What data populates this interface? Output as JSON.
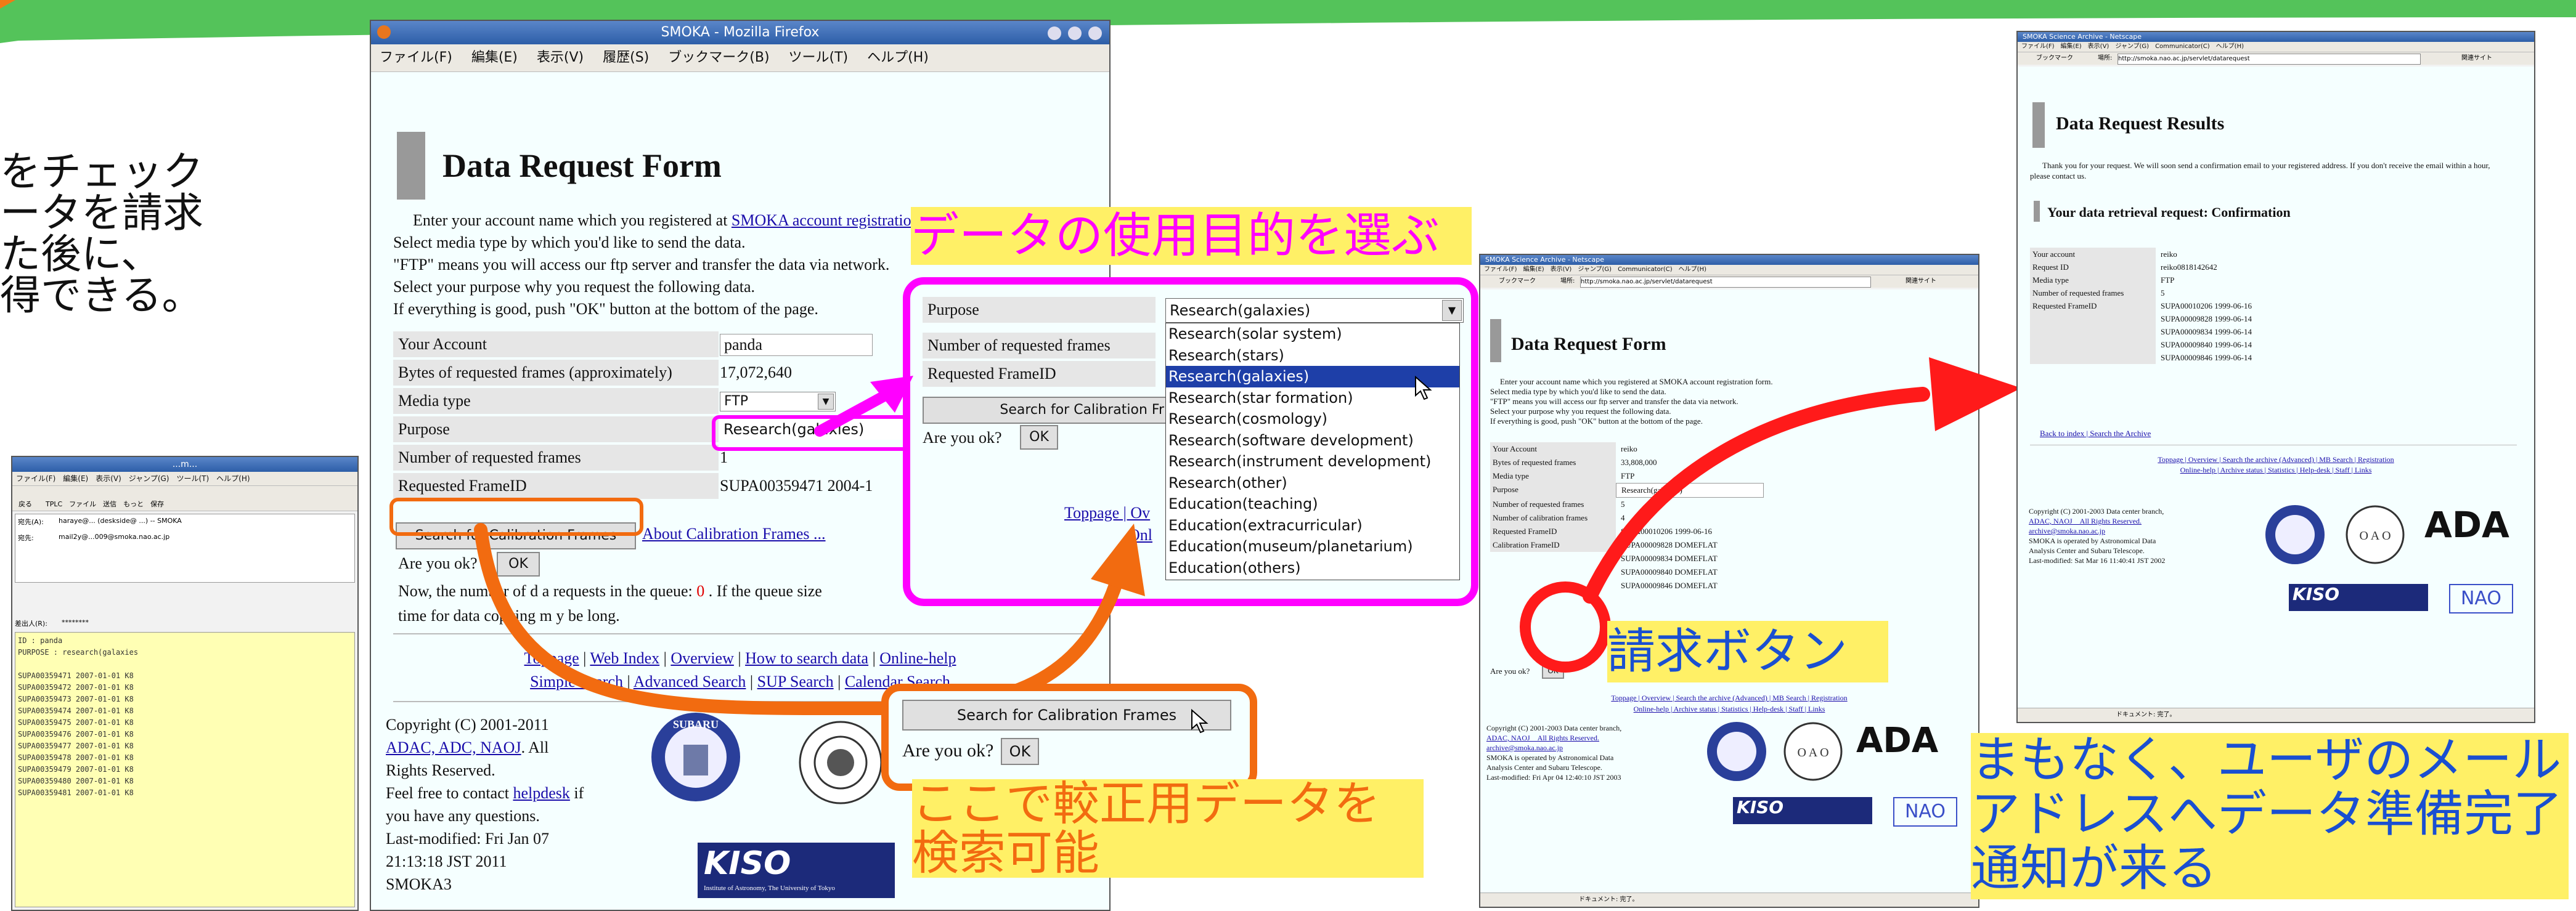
{
  "left_text": {
    "lines": [
      "をチェック",
      "ータを請求",
      "た後に、",
      "得できる。"
    ]
  },
  "small_window": {
    "title": "...m...",
    "menu": "ファイル(F)　編集(E)　表示(V)　ジャンプ(G)　ツール(T)　ヘルプ(H)",
    "toolbar": "戻る　　TPLC　ファイル　送信　もっと　保存",
    "address_label": "宛先(A):",
    "address": "haraye@... (deskside@ ...) -- SMOKA",
    "to_label": "宛先:",
    "to_value": "mail2y@...009@smoka.nao.ac.jp",
    "from_label": "差出人(R):",
    "from_value": "********",
    "body_lines": [
      "ID : panda",
      "PURPOSE : research(galaxies",
      "",
      "SUPA00359471 2007-01-01 K8",
      "SUPA00359472 2007-01-01 K8",
      "SUPA00359473 2007-01-01 K8",
      "SUPA00359474 2007-01-01 K8",
      "SUPA00359475 2007-01-01 K8",
      "SUPA00359476 2007-01-01 K8",
      "SUPA00359477 2007-01-01 K8",
      "SUPA00359478 2007-01-01 K8",
      "SUPA00359479 2007-01-01 K8",
      "SUPA00359480 2007-01-01 K8",
      "SUPA00359481 2007-01-01 K8"
    ]
  },
  "main_window": {
    "title": "SMOKA - Mozilla Firefox",
    "menu": [
      "ファイル(F)",
      "編集(E)",
      "表示(V)",
      "履歴(S)",
      "ブックマーク(B)",
      "ツール(T)",
      "ヘルプ(H)"
    ],
    "heading": "Data Request Form",
    "intro_prefix": "Enter your account name which you registered at",
    "intro_link": "SMOKA account registration form",
    "intro_lines": [
      "Select media type by which you'd like to send the data.",
      "\"FTP\" means you will access our ftp server and transfer the data via network.",
      "Select your purpose why you request the following data.",
      "If everything is good, push \"OK\" button at the bottom of the page."
    ],
    "table": {
      "account_label": "Your Account",
      "account_value": "panda",
      "bytes_label": "Bytes of requested frames (approximately)",
      "bytes_value": "17,072,640",
      "media_label": "Media type",
      "media_value": "FTP",
      "purpose_label": "Purpose",
      "purpose_value": "Research(galaxies)",
      "num_label": "Number of requested frames",
      "num_value": "1",
      "frame_label": "Requested FrameID",
      "frame_value": "SUPA00359471 2004-1"
    },
    "calib_button": "Search for Calibration Frames",
    "calib_link": "About Calibration Frames ...",
    "areyouok": "Are you ok?",
    "ok": "OK",
    "queue_prefix": "Now, the number of d",
    "queue_middle": "a requests in the queue:",
    "queue_count": "0",
    "queue_suffix": ". If the queue size",
    "queue_line2_a": "time for data copying m",
    "queue_line2_b": "y be long.",
    "nav1": [
      "Toppage",
      "Web Index",
      "Overview",
      "How to search data",
      "Online-help"
    ],
    "nav2": [
      "Simple Search",
      "Advanced Search",
      "SUP Search",
      "Calendar Search"
    ],
    "copyright": "Copyright (C) 2001-2011",
    "org_links": "ADAC, ADC, NAOJ",
    "all": ". All",
    "rights": "Rights Reserved.",
    "feelfree": "Feel free to contact",
    "helpdesk": "helpdesk",
    "feelfree_end": "if",
    "questions": "you have any questions.",
    "lastmod": "Last-modified: Fri Jan 07",
    "lastmod2": "21:13:18 JST 2011",
    "smoka": "SMOKA3"
  },
  "dropdown_zoom": {
    "purpose_label": "Purpose",
    "selected": "Research(galaxies)",
    "num_label": "Number of requested frames",
    "frame_label": "Requested FrameID",
    "calib_button": "Search for Calibration Fr",
    "areyouok": "Are you ok?",
    "ok": "OK",
    "partial_link": "Toppage | Ov",
    "partial_link2": "Onl",
    "options": [
      "Research(solar system)",
      "Research(stars)",
      "Research(galaxies)",
      "Research(star formation)",
      "Research(cosmology)",
      "Research(software development)",
      "Research(instrument development)",
      "Research(other)",
      "Education(teaching)",
      "Education(extracurricular)",
      "Education(museum/planetarium)",
      "Education(others)"
    ]
  },
  "calib_zoom": {
    "button": "Search for Calibration Frames",
    "areyouok": "Are you ok?",
    "ok": "OK"
  },
  "netscape_window": {
    "title": "SMOKA Science Archive - Netscape",
    "menu": "ファイル(F)　編集(E)　表示(V)　ジャンプ(G)　Communicator(C)　ヘルプ(H)",
    "bookmark": "ブックマーク",
    "location_label": "場所:",
    "url": "http://smoka.nao.ac.jp/servlet/datarequest",
    "related": "関連サイト",
    "heading": "Data Request Form",
    "intro": [
      "Enter your account name which you registered at SMOKA account registration form.",
      "Select media type by which you'd like to send the data.",
      "\"FTP\" means you will access our ftp server and transfer the data via network.",
      "Select your purpose why you request the following data.",
      "If everything is good, push \"OK\" button at the bottom of the page."
    ],
    "rows": [
      {
        "k": "Your Account",
        "v": "reiko"
      },
      {
        "k": "Bytes of requested frames",
        "v": "33,808,000"
      },
      {
        "k": "Media type",
        "v": "FTP"
      },
      {
        "k": "Purpose",
        "v": "Research(galaxies)"
      },
      {
        "k": "Number of requested frames",
        "v": "5"
      },
      {
        "k": "Number of calibration frames",
        "v": "4"
      },
      {
        "k": "Requested FrameID",
        "v": "SUPA00010206 1999-06-16"
      },
      {
        "k": "Calibration FrameID",
        "v": "SUPA00009828 DOMEFLAT"
      },
      {
        "k": "",
        "v": "SUPA00009834 DOMEFLAT"
      },
      {
        "k": "",
        "v": "SUPA00009840 DOMEFLAT"
      },
      {
        "k": "",
        "v": "SUPA00009846 DOMEFLAT"
      }
    ],
    "areyouok": "Are you ok?",
    "ok": "OK",
    "links1": "Toppage | Overview | Search the archive (Advanced) | MB Search | Registration",
    "links2": "Online-help | Archive status | Statistics | Help-desk | Staff | Links",
    "footer": [
      "Copyright (C) 2001-2003 Data center branch,",
      "ADAC, NAOJ　All Rights Reserved.",
      "archive@smoka.nao.ac.jp",
      "SMOKA is operated by Astronomical Data",
      "Analysis Center and Subaru Telescope.",
      "Last-modified: Fri Apr 04 12:40:10 JST 2003"
    ],
    "status": "ドキュメント: 完了。"
  },
  "results_window": {
    "title": "SMOKA Science Archive - Netscape",
    "menu": "ファイル(F)　編集(E)　表示(V)　ジャンプ(G)　Communicator(C)　ヘルプ(H)",
    "bookmark": "ブックマーク",
    "location_label": "場所:",
    "url": "http://smoka.nao.ac.jp/servlet/datarequest",
    "related": "関連サイト",
    "heading": "Data Request Results",
    "thanks": "Thank you for your request. We will soon send a confirmation email to your registered address. If you don't receive the email within a hour, please contact us.",
    "subheading": "Your data retrieval request: Confirmation",
    "rows": [
      {
        "k": "Your account",
        "v": "reiko"
      },
      {
        "k": "Request ID",
        "v": "reiko0818142642"
      },
      {
        "k": "Media type",
        "v": "FTP"
      },
      {
        "k": "Number of requested frames",
        "v": "5"
      },
      {
        "k": "Requested FrameID",
        "v": "SUPA00010206 1999-06-16"
      },
      {
        "k": "",
        "v": "SUPA00009828 1999-06-14"
      },
      {
        "k": "",
        "v": "SUPA00009834 1999-06-14"
      },
      {
        "k": "",
        "v": "SUPA00009840 1999-06-14"
      },
      {
        "k": "",
        "v": "SUPA00009846 1999-06-14"
      }
    ],
    "back": "Back to index | Search the Archive",
    "links1": "Toppage | Overview | Search the archive (Advanced) | MB Search | Registration",
    "links2": "Online-help | Archive status | Statistics | Help-desk | Staff | Links",
    "footer": [
      "Copyright (C) 2001-2003 Data center branch,",
      "ADAC, NAOJ　All Rights Reserved.",
      "archive@smoka.nao.ac.jp",
      "SMOKA is operated by Astronomical Data",
      "Analysis Center and Subaru Telescope.",
      "Last-modified: Sat Mar 16 11:40:41 JST 2002"
    ],
    "status": "ドキュメント: 完了。"
  },
  "callouts": {
    "purpose": "データの使用目的を選ぶ",
    "request_button": "請求ボタン",
    "calibration_line1": "ここで較正用データを",
    "calibration_line2": "検索可能",
    "notify_line1": "まもなく、ユーザのメール",
    "notify_line2": "アドレスへデータ準備完了",
    "notify_line3": "通知が来る"
  },
  "logos": {
    "subaru": "SUBARU",
    "kiso": "KISO",
    "kiso_sub": "Institute of Astronomy, The University of Tokyo",
    "ada": "ADA",
    "oao": "O A O",
    "nao": "NAO"
  },
  "colors": {
    "magenta": "#ff00ff",
    "orange": "#f26b10",
    "red": "#ff1a1a",
    "yellow": "#fff066",
    "green": "#3cc94a"
  }
}
